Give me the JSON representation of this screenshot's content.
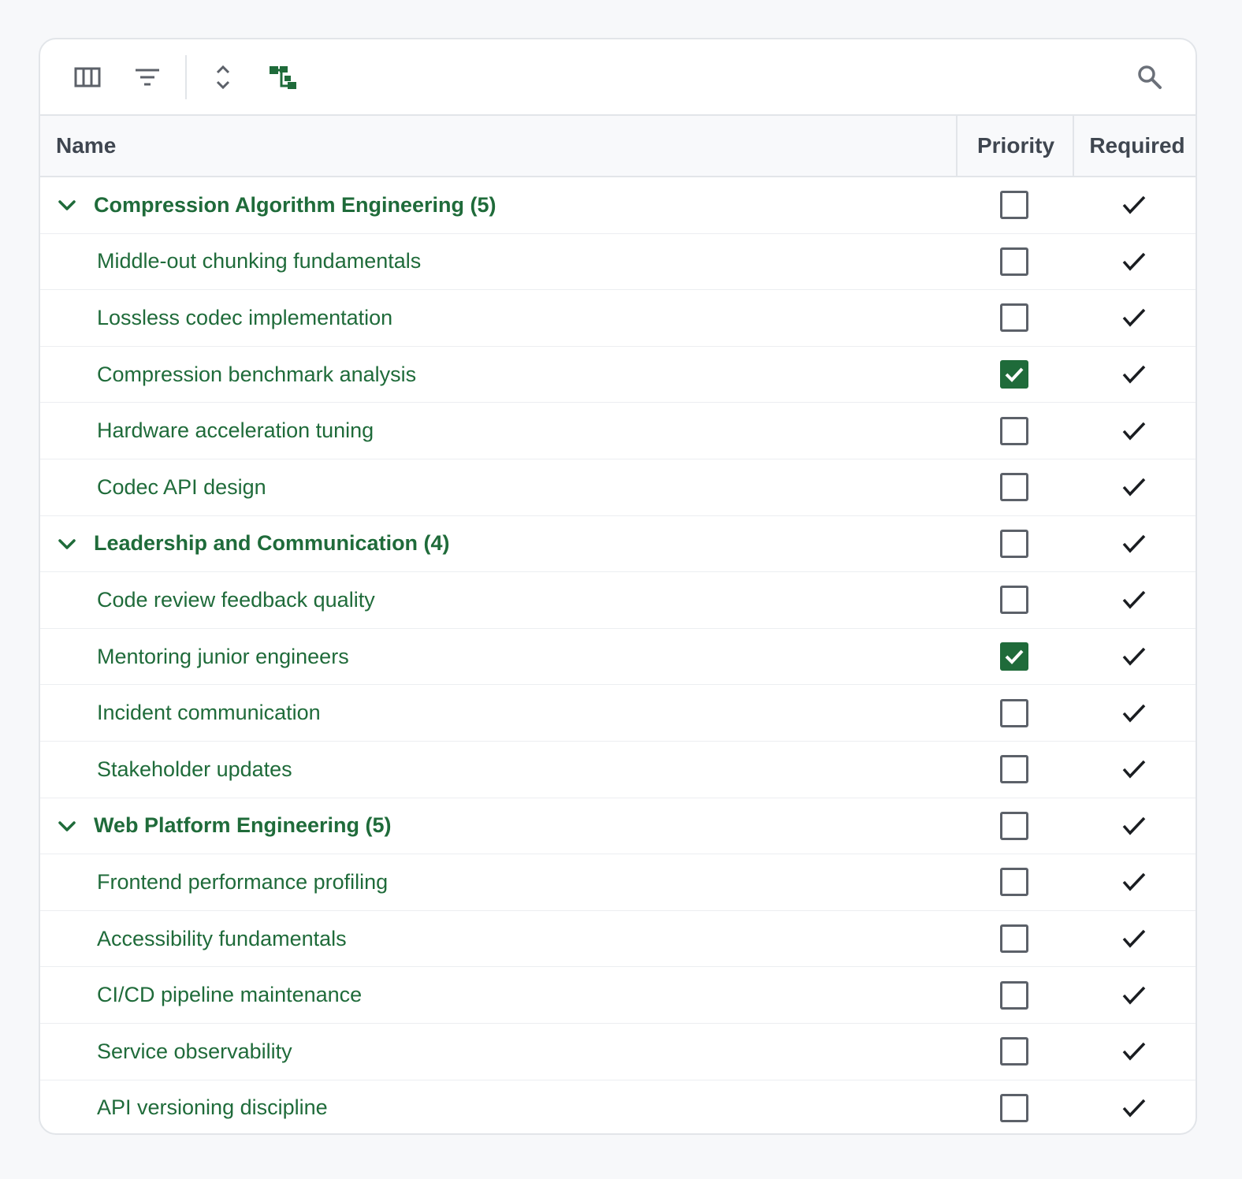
{
  "toolbar": {
    "icons": [
      "columns-icon",
      "filter-icon",
      "expand-collapse-icon",
      "tree-view-icon",
      "search-icon"
    ]
  },
  "header": {
    "name": "Name",
    "priority": "Priority",
    "required": "Required"
  },
  "colors": {
    "accent": "#1f6b3a",
    "border": "#e2e5e9",
    "header_text": "#3f4650"
  },
  "rows": [
    {
      "type": "group",
      "label": "Compression Algorithm Engineering (5)",
      "priority": false,
      "required": true
    },
    {
      "type": "child",
      "label": "Middle-out chunking fundamentals",
      "priority": false,
      "required": true
    },
    {
      "type": "child",
      "label": "Lossless codec implementation",
      "priority": false,
      "required": true
    },
    {
      "type": "child",
      "label": "Compression benchmark analysis",
      "priority": true,
      "required": true
    },
    {
      "type": "child",
      "label": "Hardware acceleration tuning",
      "priority": false,
      "required": true
    },
    {
      "type": "child",
      "label": "Codec API design",
      "priority": false,
      "required": true
    },
    {
      "type": "group",
      "label": "Leadership and Communication (4)",
      "priority": false,
      "required": true
    },
    {
      "type": "child",
      "label": "Code review feedback quality",
      "priority": false,
      "required": true
    },
    {
      "type": "child",
      "label": "Mentoring junior engineers",
      "priority": true,
      "required": true
    },
    {
      "type": "child",
      "label": "Incident communication",
      "priority": false,
      "required": true
    },
    {
      "type": "child",
      "label": "Stakeholder updates",
      "priority": false,
      "required": true
    },
    {
      "type": "group",
      "label": "Web Platform Engineering (5)",
      "priority": false,
      "required": true
    },
    {
      "type": "child",
      "label": "Frontend performance profiling",
      "priority": false,
      "required": true
    },
    {
      "type": "child",
      "label": "Accessibility fundamentals",
      "priority": false,
      "required": true
    },
    {
      "type": "child",
      "label": "CI/CD pipeline maintenance",
      "priority": false,
      "required": true
    },
    {
      "type": "child",
      "label": "Service observability",
      "priority": false,
      "required": true
    },
    {
      "type": "child",
      "label": "API versioning discipline",
      "priority": false,
      "required": true
    }
  ]
}
